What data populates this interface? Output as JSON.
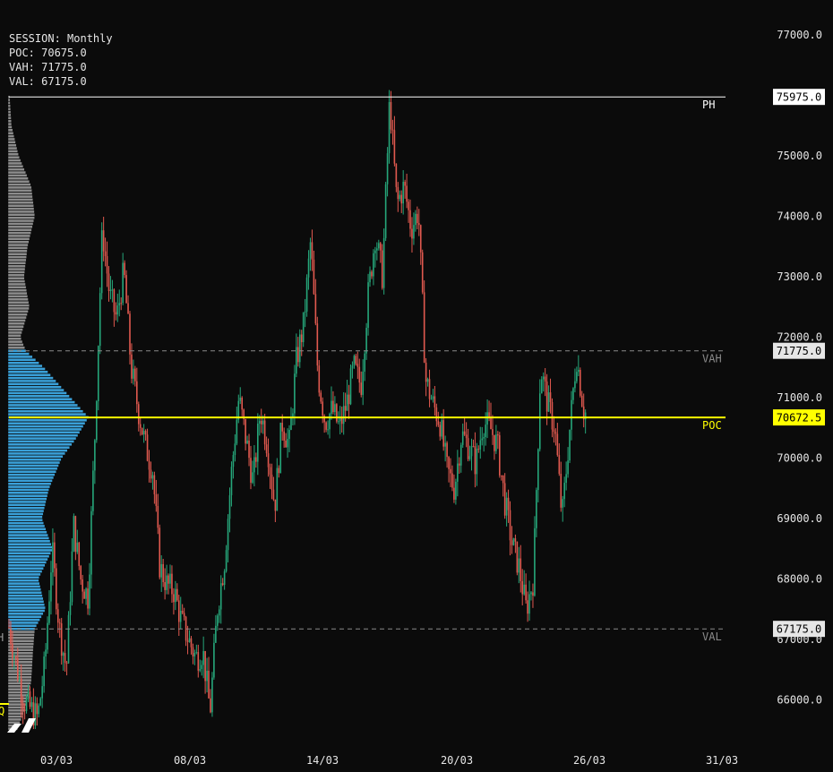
{
  "session_info": {
    "session": "SESSION: Monthly",
    "poc": "POC: 70675.0",
    "vah": "VAH: 71775.0",
    "val": "VAL: 67175.0"
  },
  "chart_data": {
    "type": "candlestick",
    "title": "",
    "price_axis": {
      "range": [
        65500,
        77500
      ],
      "ticks": [
        66000,
        67000,
        68000,
        69000,
        70000,
        71000,
        72000,
        73000,
        74000,
        75000,
        77000
      ],
      "tick_labels": [
        "66000.0",
        "67000.0",
        "68000.0",
        "69000.0",
        "70000.0",
        "71000.0",
        "72000.0",
        "73000.0",
        "74000.0",
        "75000.0",
        "77000.0"
      ]
    },
    "time_axis": {
      "labels": [
        "03/03",
        "08/03",
        "14/03",
        "20/03",
        "26/03",
        "31/03"
      ]
    },
    "levels": [
      {
        "name": "PH",
        "price": 75975.0,
        "label": "75975.0",
        "color": "#ffffff",
        "style": "solid"
      },
      {
        "name": "VAH",
        "price": 71775.0,
        "label": "71775.0",
        "color": "#8a8a8a",
        "style": "dashed"
      },
      {
        "name": "POC",
        "price": 70672.5,
        "label": "70672.5",
        "color": "#ffff00",
        "style": "solid"
      },
      {
        "name": "VAL",
        "price": 67175.0,
        "label": "67175.0",
        "color": "#8a8a8a",
        "style": "dashed"
      }
    ],
    "left_edge_labels": [
      "H",
      "Q"
    ],
    "price_path": [
      [
        0.0,
        67200
      ],
      [
        0.02,
        66000
      ],
      [
        0.04,
        65700
      ],
      [
        0.05,
        66600
      ],
      [
        0.06,
        68500
      ],
      [
        0.07,
        67200
      ],
      [
        0.08,
        66500
      ],
      [
        0.09,
        68900
      ],
      [
        0.1,
        68000
      ],
      [
        0.11,
        67700
      ],
      [
        0.12,
        70500
      ],
      [
        0.13,
        73800
      ],
      [
        0.14,
        72700
      ],
      [
        0.15,
        72300
      ],
      [
        0.16,
        73100
      ],
      [
        0.17,
        71500
      ],
      [
        0.18,
        70800
      ],
      [
        0.19,
        70200
      ],
      [
        0.2,
        69800
      ],
      [
        0.21,
        68200
      ],
      [
        0.22,
        67900
      ],
      [
        0.23,
        67800
      ],
      [
        0.24,
        67300
      ],
      [
        0.25,
        67000
      ],
      [
        0.26,
        66700
      ],
      [
        0.27,
        66800
      ],
      [
        0.28,
        65800
      ],
      [
        0.29,
        67500
      ],
      [
        0.3,
        68300
      ],
      [
        0.31,
        69800
      ],
      [
        0.32,
        71000
      ],
      [
        0.33,
        70300
      ],
      [
        0.34,
        69600
      ],
      [
        0.35,
        70800
      ],
      [
        0.36,
        70200
      ],
      [
        0.37,
        69200
      ],
      [
        0.38,
        70600
      ],
      [
        0.39,
        70200
      ],
      [
        0.4,
        71600
      ],
      [
        0.41,
        72200
      ],
      [
        0.42,
        73600
      ],
      [
        0.43,
        71400
      ],
      [
        0.44,
        70600
      ],
      [
        0.45,
        70800
      ],
      [
        0.46,
        70500
      ],
      [
        0.47,
        70900
      ],
      [
        0.48,
        71500
      ],
      [
        0.49,
        71200
      ],
      [
        0.5,
        72700
      ],
      [
        0.51,
        73700
      ],
      [
        0.52,
        73000
      ],
      [
        0.53,
        75950
      ],
      [
        0.54,
        74200
      ],
      [
        0.55,
        74500
      ],
      [
        0.56,
        73800
      ],
      [
        0.57,
        74100
      ],
      [
        0.58,
        71300
      ],
      [
        0.59,
        70900
      ],
      [
        0.6,
        70600
      ],
      [
        0.61,
        69800
      ],
      [
        0.62,
        69500
      ],
      [
        0.63,
        70400
      ],
      [
        0.64,
        70200
      ],
      [
        0.65,
        69900
      ],
      [
        0.66,
        70600
      ],
      [
        0.67,
        70500
      ],
      [
        0.68,
        70200
      ],
      [
        0.69,
        69300
      ],
      [
        0.7,
        68600
      ],
      [
        0.71,
        68200
      ],
      [
        0.72,
        67500
      ],
      [
        0.73,
        68000
      ],
      [
        0.74,
        71500
      ],
      [
        0.75,
        70900
      ],
      [
        0.76,
        70500
      ],
      [
        0.77,
        69000
      ],
      [
        0.78,
        70400
      ],
      [
        0.79,
        71700
      ],
      [
        0.8,
        70800
      ],
      [
        0.805,
        70700
      ]
    ],
    "volume_profile": {
      "poc_price": 70675,
      "value_area_color": "#3aa0d8",
      "outside_color": "#8c8c8c",
      "shape": [
        [
          75975,
          2
        ],
        [
          75500,
          4
        ],
        [
          75000,
          12
        ],
        [
          74500,
          26
        ],
        [
          74000,
          30
        ],
        [
          73500,
          22
        ],
        [
          73000,
          18
        ],
        [
          72500,
          24
        ],
        [
          72000,
          14
        ],
        [
          71775,
          20
        ],
        [
          71500,
          40
        ],
        [
          71000,
          70
        ],
        [
          70675,
          90
        ],
        [
          70300,
          75
        ],
        [
          70000,
          60
        ],
        [
          69500,
          46
        ],
        [
          69000,
          38
        ],
        [
          68500,
          50
        ],
        [
          68000,
          34
        ],
        [
          67500,
          42
        ],
        [
          67175,
          30
        ],
        [
          66800,
          28
        ],
        [
          66300,
          26
        ],
        [
          65800,
          18
        ],
        [
          65500,
          10
        ]
      ]
    },
    "colors": {
      "up": "#26a67a",
      "down": "#e0594f",
      "background": "#0b0b0b",
      "axis_text": "#e6e6e6"
    }
  }
}
